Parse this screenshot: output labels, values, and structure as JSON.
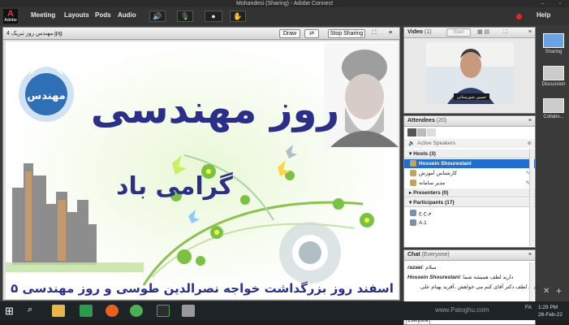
{
  "window": {
    "title": "Mohandesi (Sharing) - Adobe Connect"
  },
  "logo": {
    "mark": "A",
    "brand": "Adobe"
  },
  "menubar": {
    "items": [
      "Meeting",
      "Layouts",
      "Pods",
      "Audio"
    ],
    "help": "Help"
  },
  "share_pod": {
    "file_name": "4 مهندس روز تبریک.jpg",
    "draw": "Draw",
    "stop_sharing": "Stop Sharing"
  },
  "slide": {
    "title": "روز مهندسی",
    "subtitle": "گرامی باد",
    "footer": "۵ اسفند روز بزرگداشت  خواجه نصرالدین طوسی و روز مهندسی",
    "badge": "مهندس"
  },
  "video_pod": {
    "title": "Video",
    "count": "(1)",
    "start": "Start",
    "caption": "حسین شورستانی"
  },
  "attendees_pod": {
    "title": "Attendees",
    "count": "(20)",
    "active_speakers": "Active Speakers",
    "hosts": "Hosts (3)",
    "host_list": [
      "Hossein Shourestani",
      "کارشناس آموزش",
      "مدیر سامانه"
    ],
    "presenters": "Presenters (0)",
    "participants": "Participants (17)",
    "participant_list": [
      "م.ح.ع",
      "A.1"
    ]
  },
  "chat_pod": {
    "title": "Chat",
    "scope": "(Everyone)",
    "messages": [
      {
        "from": "razaei",
        "text": "سلام"
      },
      {
        "from": "Hossein Shourestani",
        "text": "دارید لطف همیشه شما"
      },
      {
        "from": "",
        "text": "دارید لطف دکتر آقای کنم می خواهش ،آقرید بهنام علی"
      }
    ],
    "everyone_tab": "Everyone"
  },
  "sidebar": {
    "items": [
      "Sharing",
      "Discussion",
      "Collabo..."
    ]
  },
  "taskbar": {
    "watermark": "www.Patoghu.com",
    "language": "FA",
    "time": "1:29 PM",
    "date": "26-Feb-22"
  },
  "colors": {
    "accent": "#1f6fd0",
    "slide_blue": "#2a2f8a",
    "slide_green": "#7cc242",
    "record": "#e22222"
  }
}
